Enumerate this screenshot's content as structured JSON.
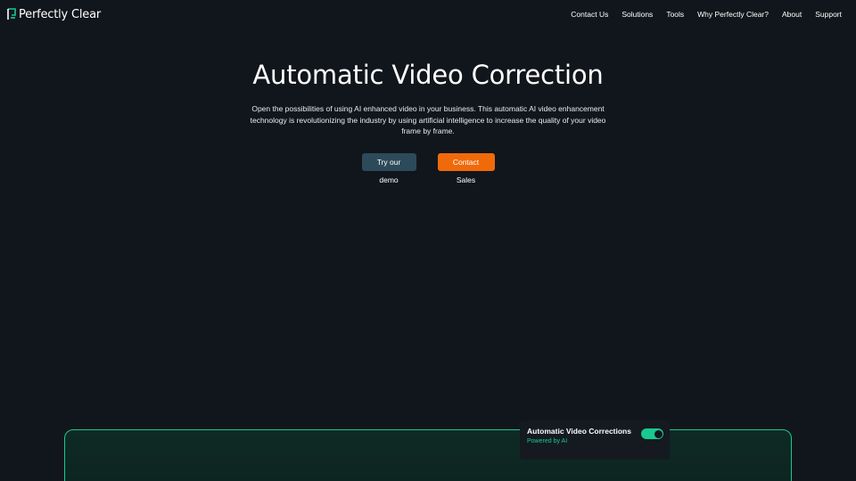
{
  "header": {
    "logo_text": "Perfectly Clear",
    "nav": [
      {
        "label": "Contact Us"
      },
      {
        "label": "Solutions"
      },
      {
        "label": "Tools"
      },
      {
        "label": "Why Perfectly Clear?"
      },
      {
        "label": "About"
      },
      {
        "label": "Support"
      }
    ]
  },
  "hero": {
    "title": "Automatic Video Correction",
    "description": "Open the possibilities of using AI enhanced video in your business. This automatic AI video enhancement technology is revolutionizing the industry by using artificial intelligence to increase the quality of your video frame by frame.",
    "demo_button": "Try our demo",
    "sales_button": "Contact Sales"
  },
  "feature_toggle": {
    "title": "Automatic Video Corrections",
    "subtitle": "Powered by AI",
    "enabled": true
  },
  "colors": {
    "background": "#11161c",
    "accent_green": "#19c98f",
    "orange": "#f06a0a",
    "demo_button": "#2c4a5a"
  }
}
